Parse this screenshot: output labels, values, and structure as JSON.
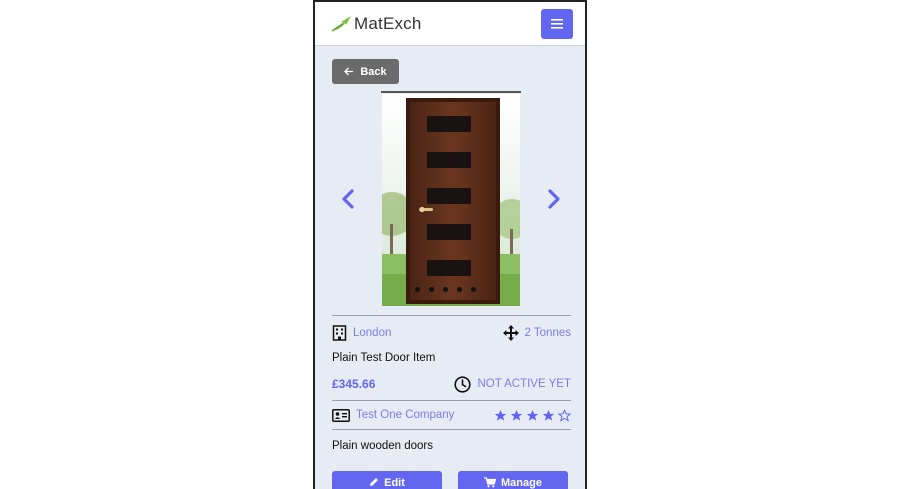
{
  "header": {
    "logo_text": "MatExch",
    "logo_icon": "leaf-icon",
    "menu_icon": "hamburger-icon"
  },
  "back_button": {
    "label": "Back",
    "icon": "arrow-left-icon"
  },
  "gallery": {
    "image": "wooden-door-photo",
    "prev_icon": "chevron-left-icon",
    "next_icon": "chevron-right-icon",
    "slide_count": 5
  },
  "item": {
    "location": "London",
    "location_icon": "building-icon",
    "quantity": "2 Tonnes",
    "quantity_icon": "move-arrows-icon",
    "title": "Plain Test Door Item",
    "price": "£345.66",
    "status": "NOT ACTIVE YET",
    "status_icon": "clock-icon",
    "company": "Test One Company",
    "company_icon": "id-card-icon",
    "rating": 4,
    "rating_max": 5,
    "description": "Plain wooden doors"
  },
  "actions": {
    "edit_label": "Edit",
    "manage_label": "Manage",
    "manage_icon": "cart-icon"
  },
  "colors": {
    "accent": "#6366f1",
    "link": "#7b7fe3",
    "background": "#e7ebf3",
    "back_button": "#6b6b6b"
  }
}
